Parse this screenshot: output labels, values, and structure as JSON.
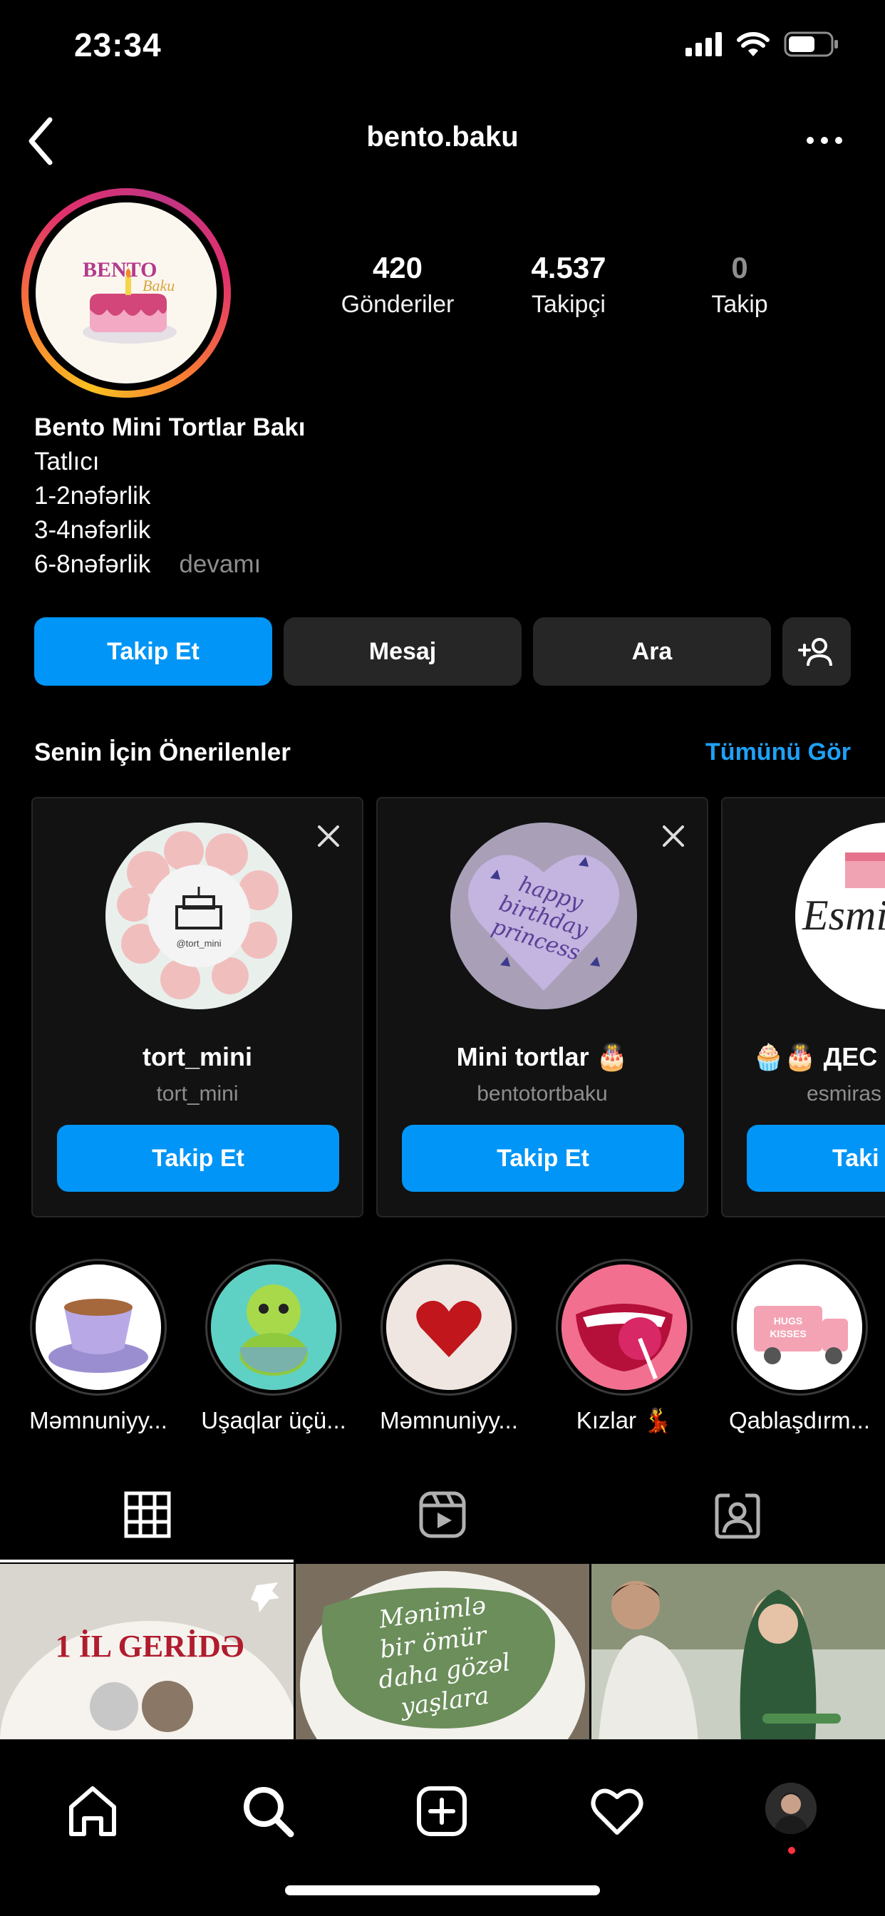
{
  "status_bar": {
    "time": "23:34"
  },
  "header": {
    "username": "bento.baku"
  },
  "profile": {
    "avatar_text_1": "BENTO",
    "avatar_text_2": "Baku",
    "stats": [
      {
        "value": "420",
        "label": "Gönderiler"
      },
      {
        "value": "4.537",
        "label": "Takipçi"
      },
      {
        "value": "0",
        "label": "Takip"
      }
    ],
    "bio": {
      "name": "Bento Mini Tortlar Bakı",
      "category": "Tatlıcı",
      "lines": [
        "1-2nəfərlik",
        "3-4nəfərlik",
        "6-8nəfərlik"
      ],
      "more": "devamı"
    }
  },
  "actions": {
    "follow": "Takip Et",
    "message": "Mesaj",
    "call": "Ara"
  },
  "suggestions": {
    "title": "Senin İçin Önerilenler",
    "see_all": "Tümünü Gör",
    "cards": [
      {
        "name": "tort_mini",
        "username": "tort_mini",
        "button": "Takip Et",
        "pic_text": "@tort_mini"
      },
      {
        "name": "Mini tortlar 🎂",
        "username": "bentotortbaku",
        "button": "Takip Et",
        "pic_text": "happy birthday princess"
      },
      {
        "name": "🧁🎂 ДЕС",
        "username": "esmiras",
        "button": "Taki",
        "pic_text": "Esmir SW"
      }
    ]
  },
  "highlights": [
    {
      "label": "Məmnuniyy..."
    },
    {
      "label": "Uşaqlar üçü..."
    },
    {
      "label": "Məmnuniyy..."
    },
    {
      "label": "Kızlar 💃"
    },
    {
      "label": "Qablaşdırm..."
    }
  ],
  "highlight_5_text": "HUGS KISSES",
  "posts": [
    {
      "text": "1 İL GERİDƏ"
    },
    {
      "text": "Mənimlə bir ömür daha gözəl yaşlara"
    },
    {
      "text": ""
    }
  ]
}
